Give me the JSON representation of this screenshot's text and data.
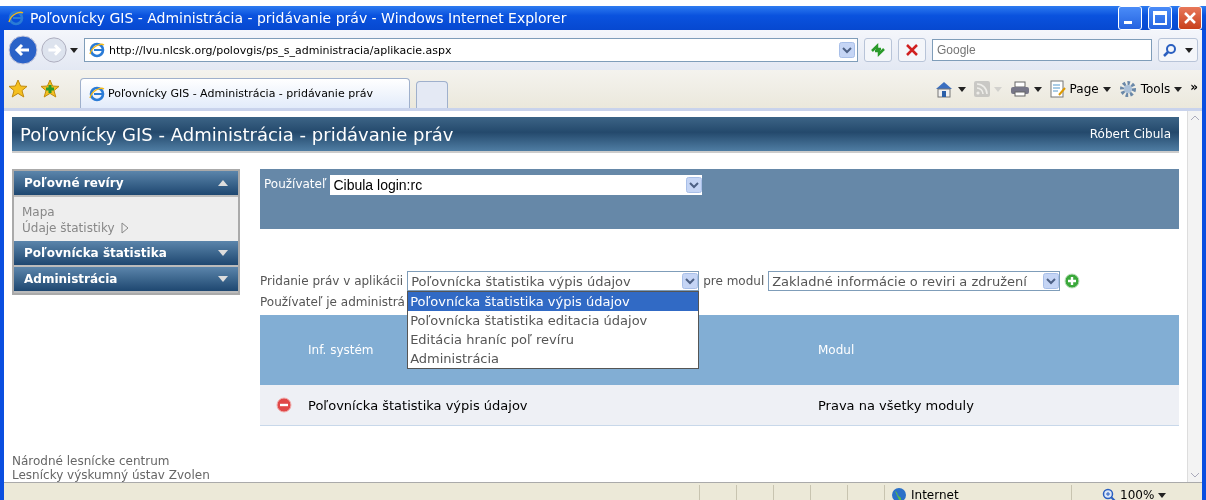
{
  "window": {
    "title": "Poľovnícky GIS - Administrácia - pridávanie práv - Windows Internet Explorer"
  },
  "address_bar": {
    "url": "http://lvu.nlcsk.org/polovgis/ps_s_administracia/aplikacie.aspx"
  },
  "search": {
    "placeholder": "Google"
  },
  "tabs": [
    {
      "label": "Poľovnícky GIS - Administrácia - pridávanie práv",
      "selected": true
    }
  ],
  "command_bar": [
    {
      "kind": "home",
      "disabled": false
    },
    {
      "kind": "feeds",
      "disabled": true
    },
    {
      "kind": "print",
      "disabled": false
    },
    {
      "kind": "page",
      "label": "Page",
      "disabled": false
    },
    {
      "kind": "tools",
      "label": "Tools",
      "disabled": false
    }
  ],
  "command_bar_more": "»",
  "page": {
    "header": {
      "title": "Poľovnícky GIS - Administrácia - pridávanie práv",
      "user": "Róbert Cibula"
    },
    "sidebar": [
      {
        "label": "Poľovné revíry",
        "expanded": true,
        "items": [
          {
            "label": "Mapa",
            "submenu": false
          },
          {
            "label": "Údaje štatistiky",
            "submenu": true
          }
        ]
      },
      {
        "label": "Poľovnícka štatistika",
        "expanded": false
      },
      {
        "label": "Administrácia",
        "expanded": false
      }
    ],
    "user_select": {
      "label": "Používateľ",
      "value": "Cibula login:rc"
    },
    "add_rights": {
      "label": "Pridanie práv v aplikácii",
      "value": "Poľovnícka štatistika výpis údajov",
      "options": [
        {
          "label": "Poľovnícka štatistika výpis údajov",
          "selected": true
        },
        {
          "label": "Poľovnícka štatistika editacia údajov",
          "selected": false
        },
        {
          "label": "Editácia hraníc poľ revíru",
          "selected": false
        },
        {
          "label": "Administrácia",
          "selected": false
        }
      ],
      "module_label": "pre modul",
      "module_value": "Zakladné informácie o reviri a združení"
    },
    "admin_note": "Používateľ je administrá",
    "table": {
      "columns": [
        "Inf. systém",
        "Modul"
      ],
      "rows": [
        {
          "system": "Poľovnícka štatistika výpis údajov",
          "module": "Prava na všetky moduly"
        }
      ]
    },
    "footer": [
      "Národné lesnícke centrum",
      "Lesnícky výskumný ústav Zvolen"
    ]
  },
  "status_bar": {
    "zone": "Internet",
    "zoom": "100%"
  }
}
